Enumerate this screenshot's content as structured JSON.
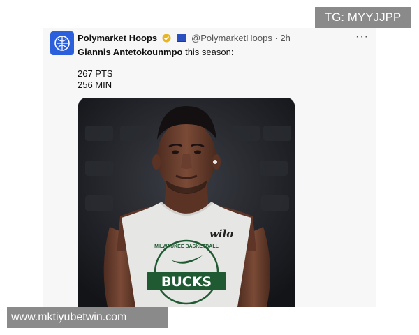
{
  "watermarks": {
    "top": "TG: MYYJJPP",
    "bottom": "www.mktiyubetwin.com"
  },
  "tweet": {
    "account_name": "Polymarket Hoops",
    "handle": "@PolymarketHoops",
    "separator": "·",
    "time": "2h",
    "more_label": "···",
    "player_name": "Giannis Antetokounmpo",
    "text_suffix": " this season:",
    "stats": [
      "267 PTS",
      "256 MIN"
    ],
    "image": {
      "icons": [
        "polymarket-logo-icon",
        "verified-badge-icon",
        "flag-badge-icon"
      ],
      "jersey_text": "BUCKS",
      "jersey_arc_text": "MILWAUKEE BASKETBALL",
      "jersey_brand": "wilo",
      "colors": {
        "jersey": "#e6e6e4",
        "bucks_green": "#1f5a33",
        "background": "#1c1e22",
        "skin": "#6b4030",
        "avatar": "#2b5fdc"
      }
    }
  }
}
